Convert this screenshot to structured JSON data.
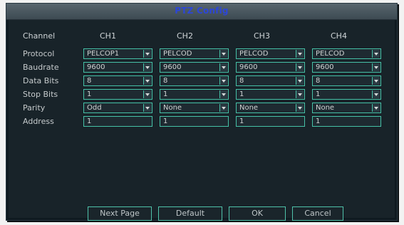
{
  "window": {
    "title": "PTZ Config"
  },
  "labels": {
    "channel": "Channel",
    "protocol": "Protocol",
    "baudrate": "Baudrate",
    "data_bits": "Data Bits",
    "stop_bits": "Stop Bits",
    "parity": "Parity",
    "address": "Address"
  },
  "channels": [
    {
      "name": "CH1",
      "protocol": "PELCOP1",
      "baudrate": "9600",
      "data_bits": "8",
      "stop_bits": "1",
      "parity": "Odd",
      "address": "1"
    },
    {
      "name": "CH2",
      "protocol": "PELCOD",
      "baudrate": "9600",
      "data_bits": "8",
      "stop_bits": "1",
      "parity": "None",
      "address": "1"
    },
    {
      "name": "CH3",
      "protocol": "PELCOD",
      "baudrate": "9600",
      "data_bits": "8",
      "stop_bits": "1",
      "parity": "None",
      "address": "1"
    },
    {
      "name": "CH4",
      "protocol": "PELCOD",
      "baudrate": "9600",
      "data_bits": "8",
      "stop_bits": "1",
      "parity": "None",
      "address": "1"
    }
  ],
  "buttons": {
    "next_page": "Next Page",
    "default": "Default",
    "ok": "OK",
    "cancel": "Cancel"
  },
  "colors": {
    "accent": "#46c1a7",
    "title": "#2c46d8",
    "background": "#182329"
  }
}
